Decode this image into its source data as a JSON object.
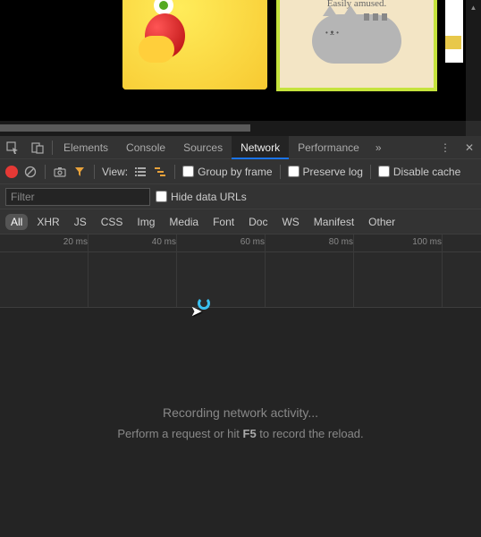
{
  "page": {
    "images": [
      {
        "name": "emoji-eating-apple",
        "selected": false
      },
      {
        "name": "pusheen-cat",
        "selected": true,
        "caption": "Easily amused."
      },
      {
        "name": "partial-image",
        "selected": false
      }
    ]
  },
  "devtools": {
    "tabs": [
      "Elements",
      "Console",
      "Sources",
      "Network",
      "Performance"
    ],
    "active_tab": "Network",
    "toolbar": {
      "recording": true,
      "view_label": "View:",
      "group_by_frame_label": "Group by frame",
      "group_by_frame_checked": false,
      "preserve_log_label": "Preserve log",
      "preserve_log_checked": false,
      "disable_cache_label": "Disable cache",
      "disable_cache_checked": false
    },
    "filter": {
      "placeholder": "Filter",
      "value": "",
      "hide_data_urls_label": "Hide data URLs",
      "hide_data_urls_checked": false
    },
    "types": [
      "All",
      "XHR",
      "JS",
      "CSS",
      "Img",
      "Media",
      "Font",
      "Doc",
      "WS",
      "Manifest",
      "Other"
    ],
    "active_type": "All",
    "timeline": {
      "ticks": [
        "20 ms",
        "40 ms",
        "60 ms",
        "80 ms",
        "100 ms"
      ]
    },
    "empty": {
      "title": "Recording network activity...",
      "subtext_before": "Perform a request or hit ",
      "subtext_key": "F5",
      "subtext_after": " to record the reload."
    }
  }
}
